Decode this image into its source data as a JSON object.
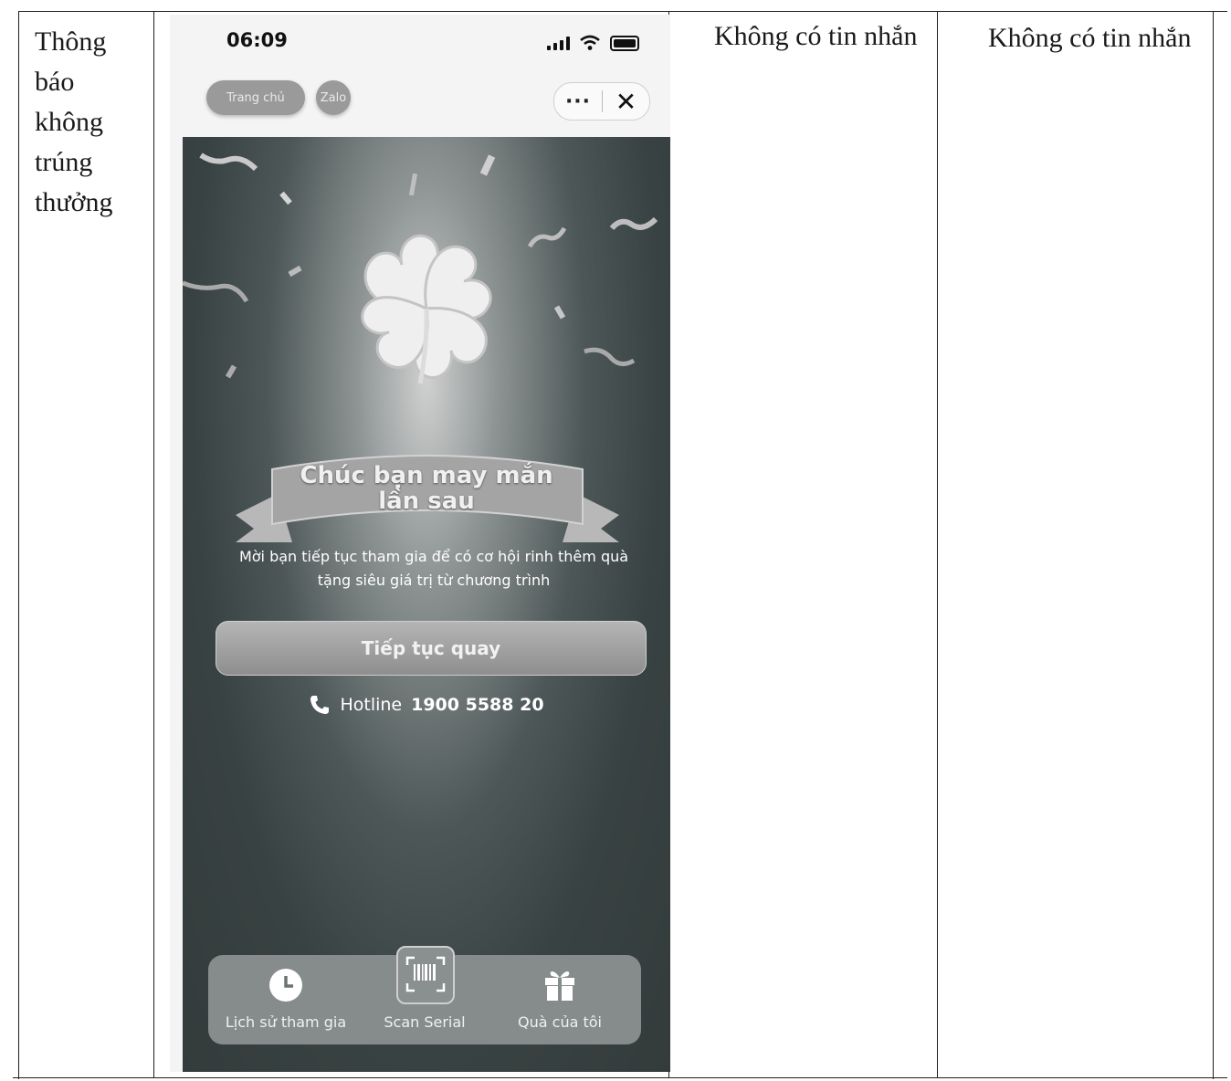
{
  "table": {
    "row_label": [
      "Thông",
      "báo",
      "không",
      "trúng",
      "thưởng"
    ],
    "col3_text": "Không có tin nhắn",
    "col4_text": "Không có tin nhắn"
  },
  "phone": {
    "status_time": "06:09",
    "pill_home": "Trang chủ",
    "pill_zalo": "Zalo",
    "menu_dots": "···",
    "menu_close": "✕",
    "ribbon_line1": "Chúc bạn may mắn",
    "ribbon_line2": "lần sau",
    "message_line1": "Mời bạn tiếp tục tham gia để có cơ hội rinh thêm quà",
    "message_line2": "tặng siêu giá trị từ chương trình",
    "continue_button": "Tiếp tục quay",
    "hotline_label": "Hotline",
    "hotline_number": "1900 5588 20",
    "nav": {
      "history": "Lịch sử tham gia",
      "scan": "Scan Serial",
      "gifts": "Quà của tôi"
    }
  },
  "icons": [
    "signal-icon",
    "wifi-icon",
    "battery-icon",
    "clover-icon",
    "phone-icon",
    "clock-icon",
    "barcode-icon",
    "gift-icon"
  ]
}
